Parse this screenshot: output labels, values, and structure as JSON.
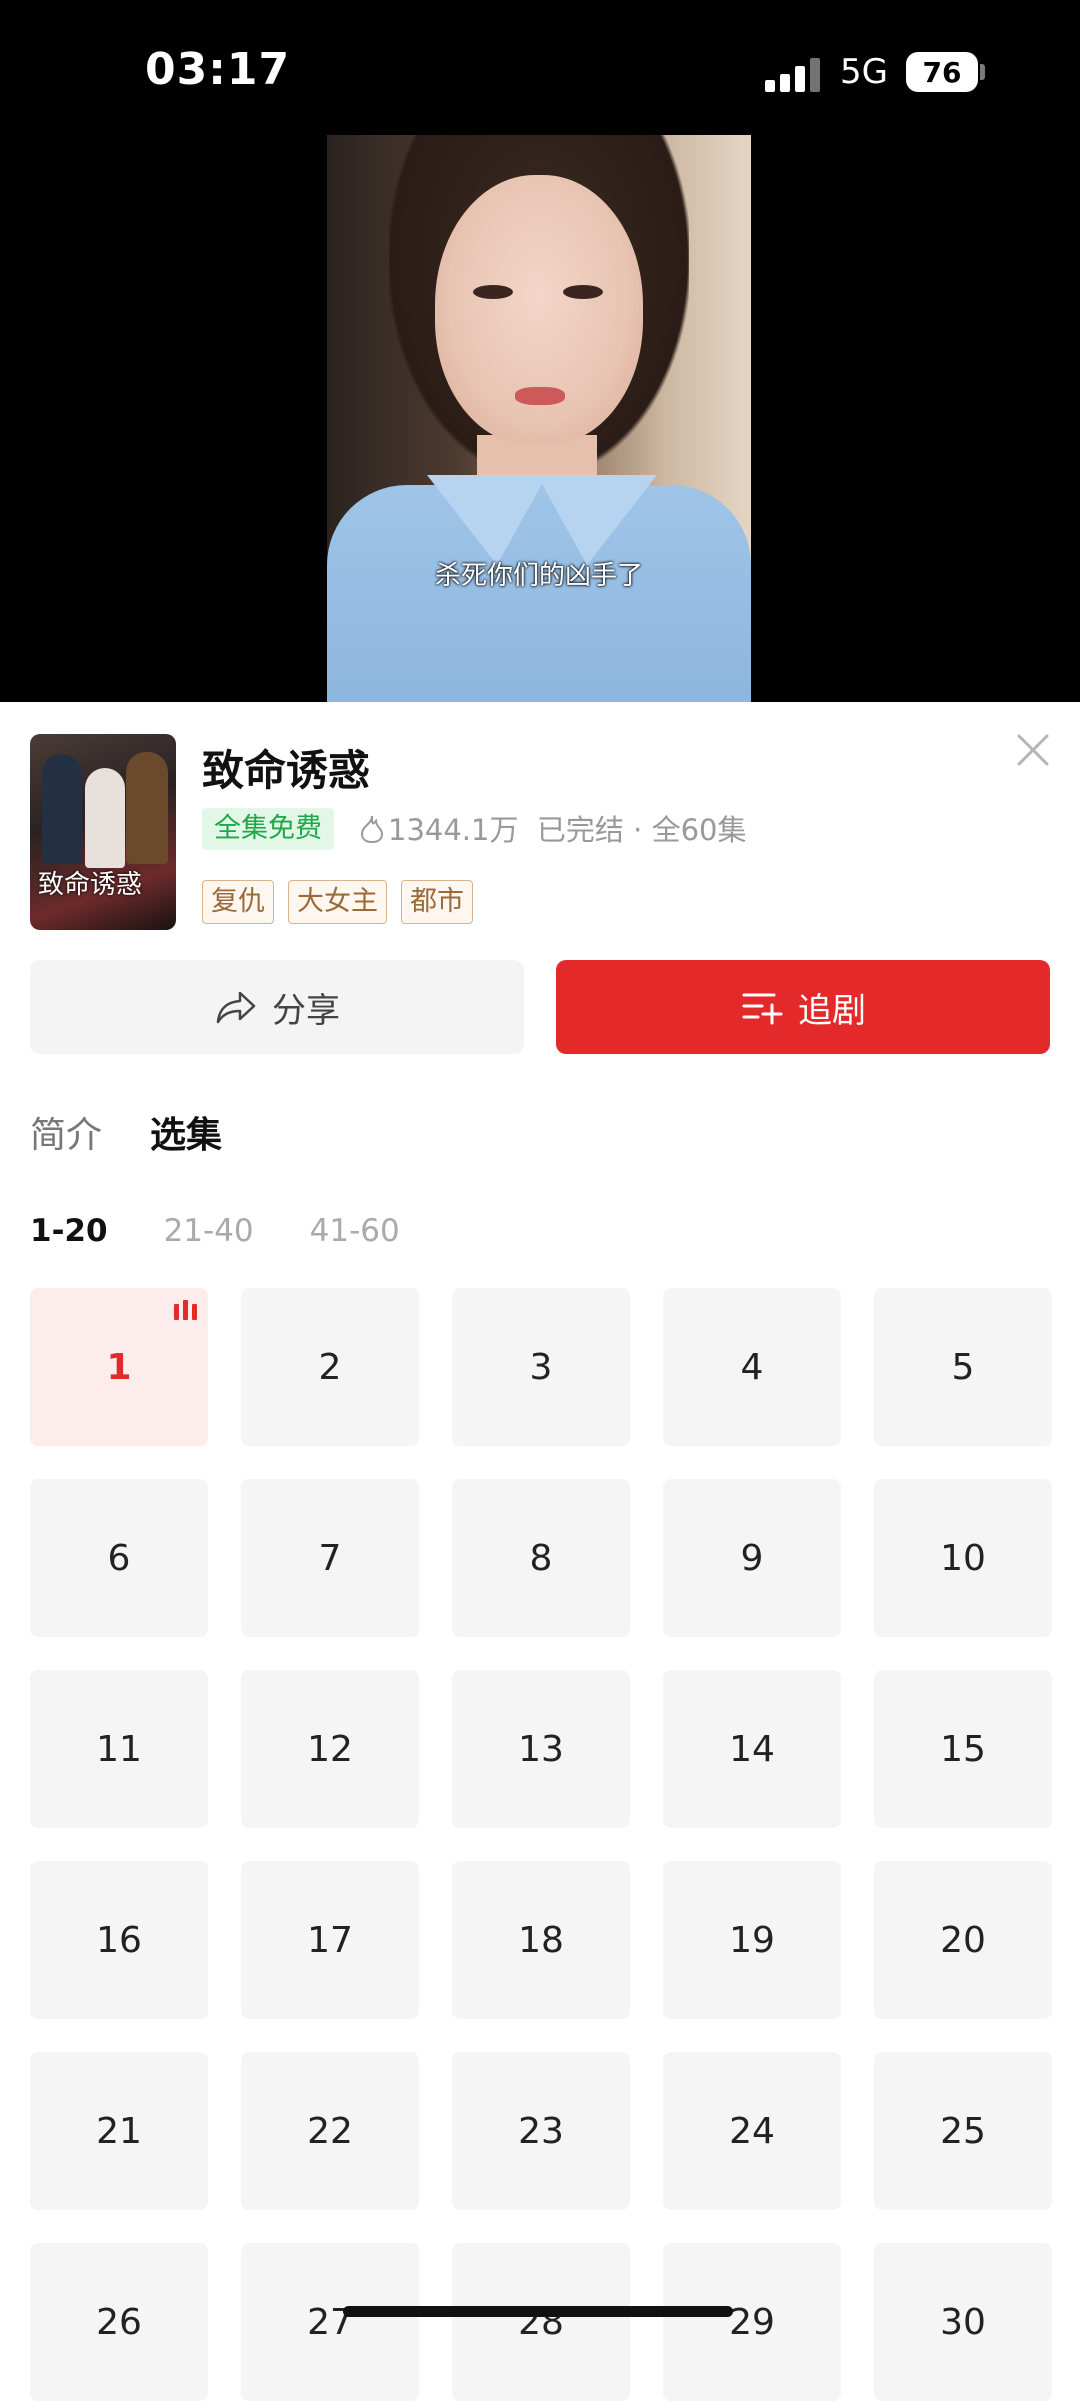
{
  "status_bar": {
    "time": "03:17",
    "network": "5G",
    "battery": "76"
  },
  "video": {
    "subtitle": "杀死你们的凶手了"
  },
  "drama": {
    "poster_title": "致命诱惑",
    "title": "致命诱惑",
    "free_badge": "全集免费",
    "heat": "1344.1万",
    "status": "已完结 · 全60集",
    "tags": [
      "复仇",
      "大女主",
      "都市"
    ]
  },
  "actions": {
    "share_label": "分享",
    "follow_label": "追剧"
  },
  "tabs": {
    "intro": "简介",
    "episodes": "选集"
  },
  "ranges": [
    "1-20",
    "21-40",
    "41-60"
  ],
  "active_range": "1-20",
  "episodes": [
    "1",
    "2",
    "3",
    "4",
    "5",
    "6",
    "7",
    "8",
    "9",
    "10",
    "11",
    "12",
    "13",
    "14",
    "15",
    "16",
    "17",
    "18",
    "19",
    "20",
    "21",
    "22",
    "23",
    "24",
    "25",
    "26",
    "27",
    "28",
    "29",
    "30"
  ],
  "current_episode": "1",
  "colors": {
    "accent": "#e3292a",
    "free_green": "#1fa84a",
    "tag_brown": "#9a6a3a"
  }
}
